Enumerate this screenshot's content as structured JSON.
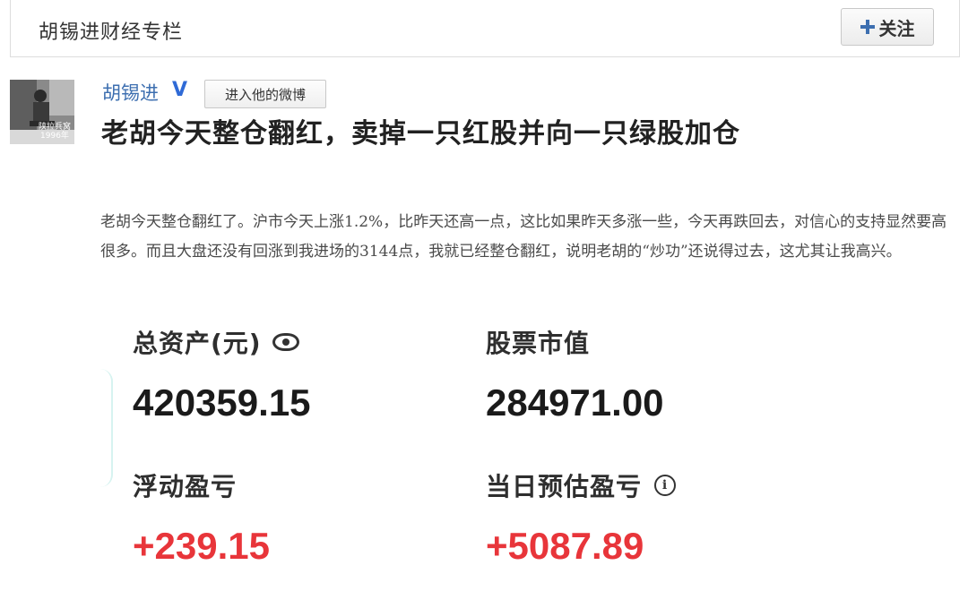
{
  "column": {
    "title": "胡锡进财经专栏",
    "follow_label": "关注"
  },
  "author": {
    "name": "胡锡进",
    "verified_badge": "V",
    "weibo_label": "进入他的微博",
    "avatar_caption_1": "陕拉兵窝",
    "avatar_caption_2": "1996年"
  },
  "article": {
    "headline": "老胡今天整仓翻红，卖掉一只红股并向一只绿股加仓",
    "paragraph": "老胡今天整仓翻红了。沪市今天上涨1.2%，比昨天还高一点，这比如果昨天多涨一些，今天再跌回去，对信心的支持显然要高很多。而且大盘还没有回涨到我进场的3144点，我就已经整仓翻红，说明老胡的“炒功”还说得过去，这尤其让我高兴。"
  },
  "assets": {
    "total_label": "总资产(元)",
    "total_value": "420359.15",
    "market_label": "股票市值",
    "market_value": "284971.00",
    "float_label": "浮动盈亏",
    "float_value": "+239.15",
    "daily_label": "当日预估盈亏",
    "daily_value": "+5087.89",
    "info_glyph": "i",
    "gain_color": "#e8353a"
  }
}
